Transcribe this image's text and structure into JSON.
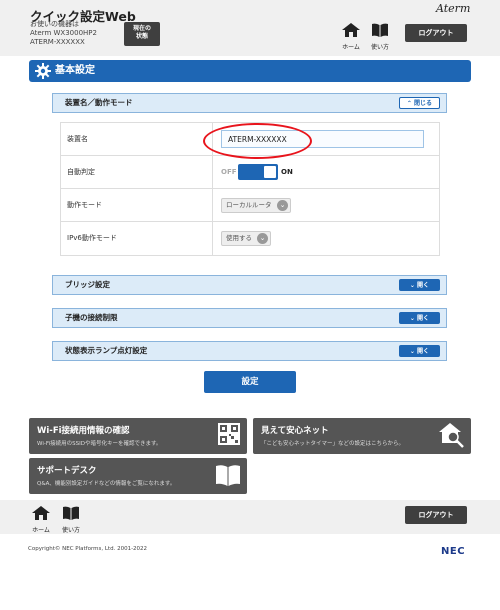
{
  "header": {
    "title": "クイック設定Web",
    "device_label": "お使いの機器は",
    "model": "Aterm  WX3000HP2",
    "device_name": "ATERM-XXXXXX",
    "status_button_line1": "現在の",
    "status_button_line2": "状態",
    "brand": "Aterm",
    "home_label": "ホーム",
    "manual_label": "使い方",
    "logout_label": "ログアウト"
  },
  "section": {
    "title": "基本設定"
  },
  "panel_main": {
    "title": "装置名／動作モード",
    "toggle_label": "閉じる"
  },
  "settings": {
    "device_name_label": "装置名",
    "device_name_value": "ATERM-XXXXXX",
    "auto_detect_label": "自動判定",
    "auto_detect_off": "OFF",
    "auto_detect_on": "ON",
    "op_mode_label": "動作モード",
    "op_mode_value": "ローカルルータ",
    "ipv6_label": "IPv6動作モード",
    "ipv6_value": "使用する"
  },
  "panels": [
    {
      "title": "ブリッジ設定",
      "toggle_label": "開く"
    },
    {
      "title": "子機の接続制限",
      "toggle_label": "開く"
    },
    {
      "title": "状態表示ランプ点灯設定",
      "toggle_label": "開く"
    }
  ],
  "apply_label": "設定",
  "tiles": {
    "wifi_title": "Wi-Fi接続用情報の確認",
    "wifi_sub": "Wi-Fi接続用のSSIDや暗号化キーを確認できます。",
    "anshin_title": "見えて安心ネット",
    "anshin_sub": "「こども安心ネットタイマー」などの設定はこちらから。",
    "support_title": "サポートデスク",
    "support_sub": "Q&A、機能別設定ガイドなどの情報をご覧になれます。"
  },
  "footer": {
    "home_label": "ホーム",
    "manual_label": "使い方",
    "logout_label": "ログアウト",
    "copyright": "Copyright© NEC Platforms, Ltd. 2001-2022",
    "nec": "NEC"
  }
}
